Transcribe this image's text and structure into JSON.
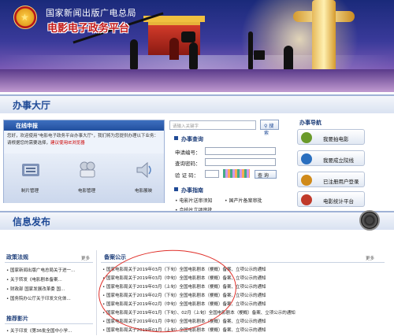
{
  "header": {
    "org_name": "国家新闻出版广电总局",
    "platform_name": "电影电子政务平台"
  },
  "service_hall": {
    "title": "办事大厅"
  },
  "online_application": {
    "title": "在线申报",
    "notice": "您好，欢迎使用\"电影电子政务平台办事大厅\"，我们将为您提供办理以下业务：请根据您的需要选择，",
    "notice_highlight": "建议使用IE浏览器",
    "tiles": [
      {
        "label": "制片管理",
        "icon": "film-reel-icon"
      },
      {
        "label": "电影管理",
        "icon": "projector-icon"
      },
      {
        "label": "电影展映",
        "icon": "speaker-icon"
      }
    ]
  },
  "search": {
    "placeholder": "请输入关键字",
    "button_label": "搜索"
  },
  "business_query": {
    "title": "办事查询",
    "application_no_label": "申请编号：",
    "password_label": "查询密码：",
    "captcha_label": "验 证 码：",
    "query_button": "查 询"
  },
  "business_guide": {
    "title": "办事指南",
    "links": [
      "电影片送审须知",
      "国产片备案审批",
      "合拍片立项审批"
    ]
  },
  "service_nav": {
    "title": "办事导航",
    "items": [
      {
        "label": "我要拍电影",
        "icon": "film-strip-icon",
        "color": "#6a9a2a"
      },
      {
        "label": "我要成立院线",
        "icon": "building-icon",
        "color": "#2a6fbf"
      },
      {
        "label": "已注册用户登录",
        "icon": "user-icon",
        "color": "#d08a1a"
      },
      {
        "label": "电影统计平台",
        "icon": "chart-icon",
        "color": "#c03a2a"
      }
    ]
  },
  "info_release": {
    "title": "信息发布"
  },
  "policy": {
    "title": "政策法规",
    "more": "更多",
    "items": [
      "国家新闻出版广电总局关于进一...",
      "关于转发《电影剧本备案...",
      "财政部 国家发展改革委 国...",
      "国务院办公厅关于印发文化体..."
    ]
  },
  "recommended": {
    "title": "推荐影片",
    "items": [
      "关于印发《第36批全国中小学..."
    ]
  },
  "announcements": {
    "title": "备案公示",
    "more": "更多",
    "items": [
      "国家电影局关于2019年03月（下旬）全国电影剧本（梗概）备案、立项公示的通知",
      "国家电影局关于2019年03月（中旬）全国电影剧本（梗概）备案、立项公示的通知",
      "国家电影局关于2019年03月（上旬）全国电影剧本（梗概）备案、立项公示的通知",
      "国家电影局关于2019年02月（下旬）全国电影剧本（梗概）备案、立项公示的通知",
      "国家电影局关于2019年02月（中旬）全国电影剧本（梗概）备案、立项公示的通知",
      "国家电影局关于2019年01月（下旬）、02月（上旬）全国电影剧本（梗概）备案、立项公示的通知",
      "国家电影局关于2019年01月（中旬）全国电影剧本（梗概）备案、立项公示的通知",
      "国家电影局关于2019年01月（上旬）全国电影剧本（梗概）备案、立项公示的通知"
    ]
  }
}
